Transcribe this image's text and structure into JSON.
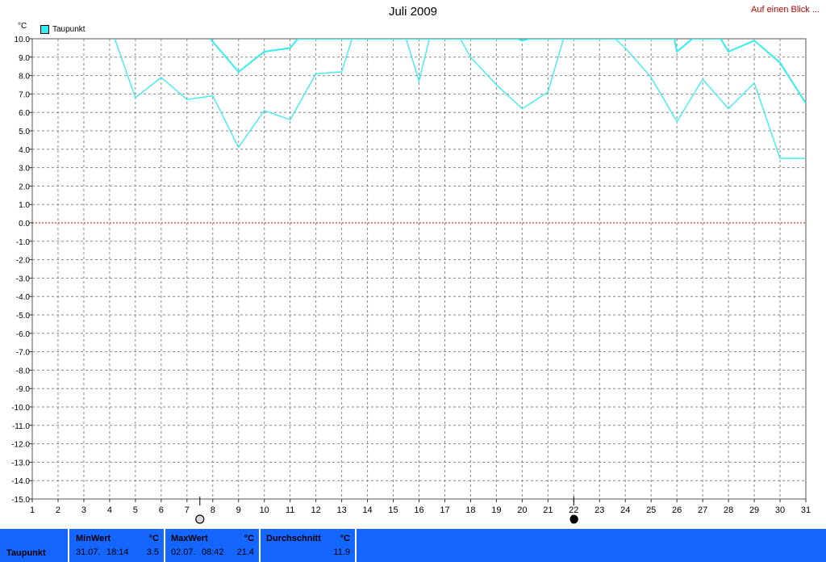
{
  "header": {
    "title": "Juli 2009",
    "link": "Auf einen Blick ..."
  },
  "legend": {
    "unit": "°C",
    "series_label": "Taupunkt"
  },
  "colors": {
    "series": "#33eeee",
    "zero_line": "#cc0000",
    "grid": "#888888",
    "footer_bg": "#1565ff"
  },
  "chart_data": {
    "type": "line",
    "title": "Juli 2009",
    "ylabel": "°C",
    "ylim": [
      -15,
      10
    ],
    "xlim": [
      1,
      31
    ],
    "y_ticks": [
      "10.0",
      "9.0",
      "8.0",
      "7.0",
      "6.0",
      "5.0",
      "4.0",
      "3.0",
      "2.0",
      "1.0",
      "0.0",
      "-1.0",
      "-2.0",
      "-3.0",
      "-4.0",
      "-5.0",
      "-6.0",
      "-7.0",
      "-8.0",
      "-9.0",
      "-10.0",
      "-11.0",
      "-12.0",
      "-13.0",
      "-14.0",
      "-15.0"
    ],
    "x_ticks": [
      "1",
      "2",
      "3",
      "4",
      "5",
      "6",
      "7",
      "8",
      "9",
      "10",
      "11",
      "12",
      "13",
      "14",
      "15",
      "16",
      "17",
      "18",
      "19",
      "20",
      "21",
      "22",
      "23",
      "24",
      "25",
      "26",
      "27",
      "28",
      "29",
      "30",
      "31"
    ],
    "grid": true,
    "series": [
      {
        "name": "Taupunkt max",
        "points": [
          [
            7.9,
            10.0
          ],
          [
            9,
            8.2
          ],
          [
            10,
            9.3
          ],
          [
            11,
            9.5
          ],
          [
            11.3,
            10.0
          ],
          [
            19.8,
            10.0
          ],
          [
            20,
            9.9
          ],
          [
            20.3,
            10.0
          ],
          [
            25.9,
            10.0
          ],
          [
            26,
            9.3
          ],
          [
            26.6,
            10.0
          ],
          [
            27.7,
            10.0
          ],
          [
            28,
            9.3
          ],
          [
            29,
            9.9
          ],
          [
            30,
            8.7
          ],
          [
            31,
            6.5
          ]
        ]
      },
      {
        "name": "Taupunkt min",
        "points": [
          [
            4.2,
            10.0
          ],
          [
            5,
            6.8
          ],
          [
            6,
            7.9
          ],
          [
            7,
            6.7
          ],
          [
            8,
            6.9
          ],
          [
            9,
            4.1
          ],
          [
            10,
            6.1
          ],
          [
            11,
            5.6
          ],
          [
            12,
            8.1
          ],
          [
            13,
            8.2
          ],
          [
            13.4,
            10.0
          ],
          [
            15.5,
            10.0
          ],
          [
            16,
            7.7
          ],
          [
            16.4,
            10.0
          ],
          [
            17.6,
            10.0
          ],
          [
            18,
            9.0
          ],
          [
            19,
            7.5
          ],
          [
            20,
            6.2
          ],
          [
            21,
            7.1
          ],
          [
            21.6,
            10.0
          ],
          [
            23.6,
            10.0
          ],
          [
            24,
            9.5
          ],
          [
            25,
            7.9
          ],
          [
            26,
            5.5
          ],
          [
            27,
            7.8
          ],
          [
            28,
            6.2
          ],
          [
            29,
            7.6
          ],
          [
            30,
            3.5
          ],
          [
            31,
            3.5
          ]
        ]
      }
    ],
    "moon_markers": [
      {
        "day": 7.5,
        "phase": "full"
      },
      {
        "day": 22,
        "phase": "new"
      }
    ]
  },
  "footer": {
    "label": "Taupunkt",
    "cells": [
      {
        "title": "MinWert",
        "unit": "°C",
        "date": "31.07.",
        "time": "18:14",
        "value": "3.5"
      },
      {
        "title": "MaxWert",
        "unit": "°C",
        "date": "02.07.",
        "time": "08:42",
        "value": "21.4"
      },
      {
        "title": "Durchschnitt",
        "unit": "°C",
        "date": "",
        "time": "",
        "value": "11.9"
      }
    ]
  }
}
